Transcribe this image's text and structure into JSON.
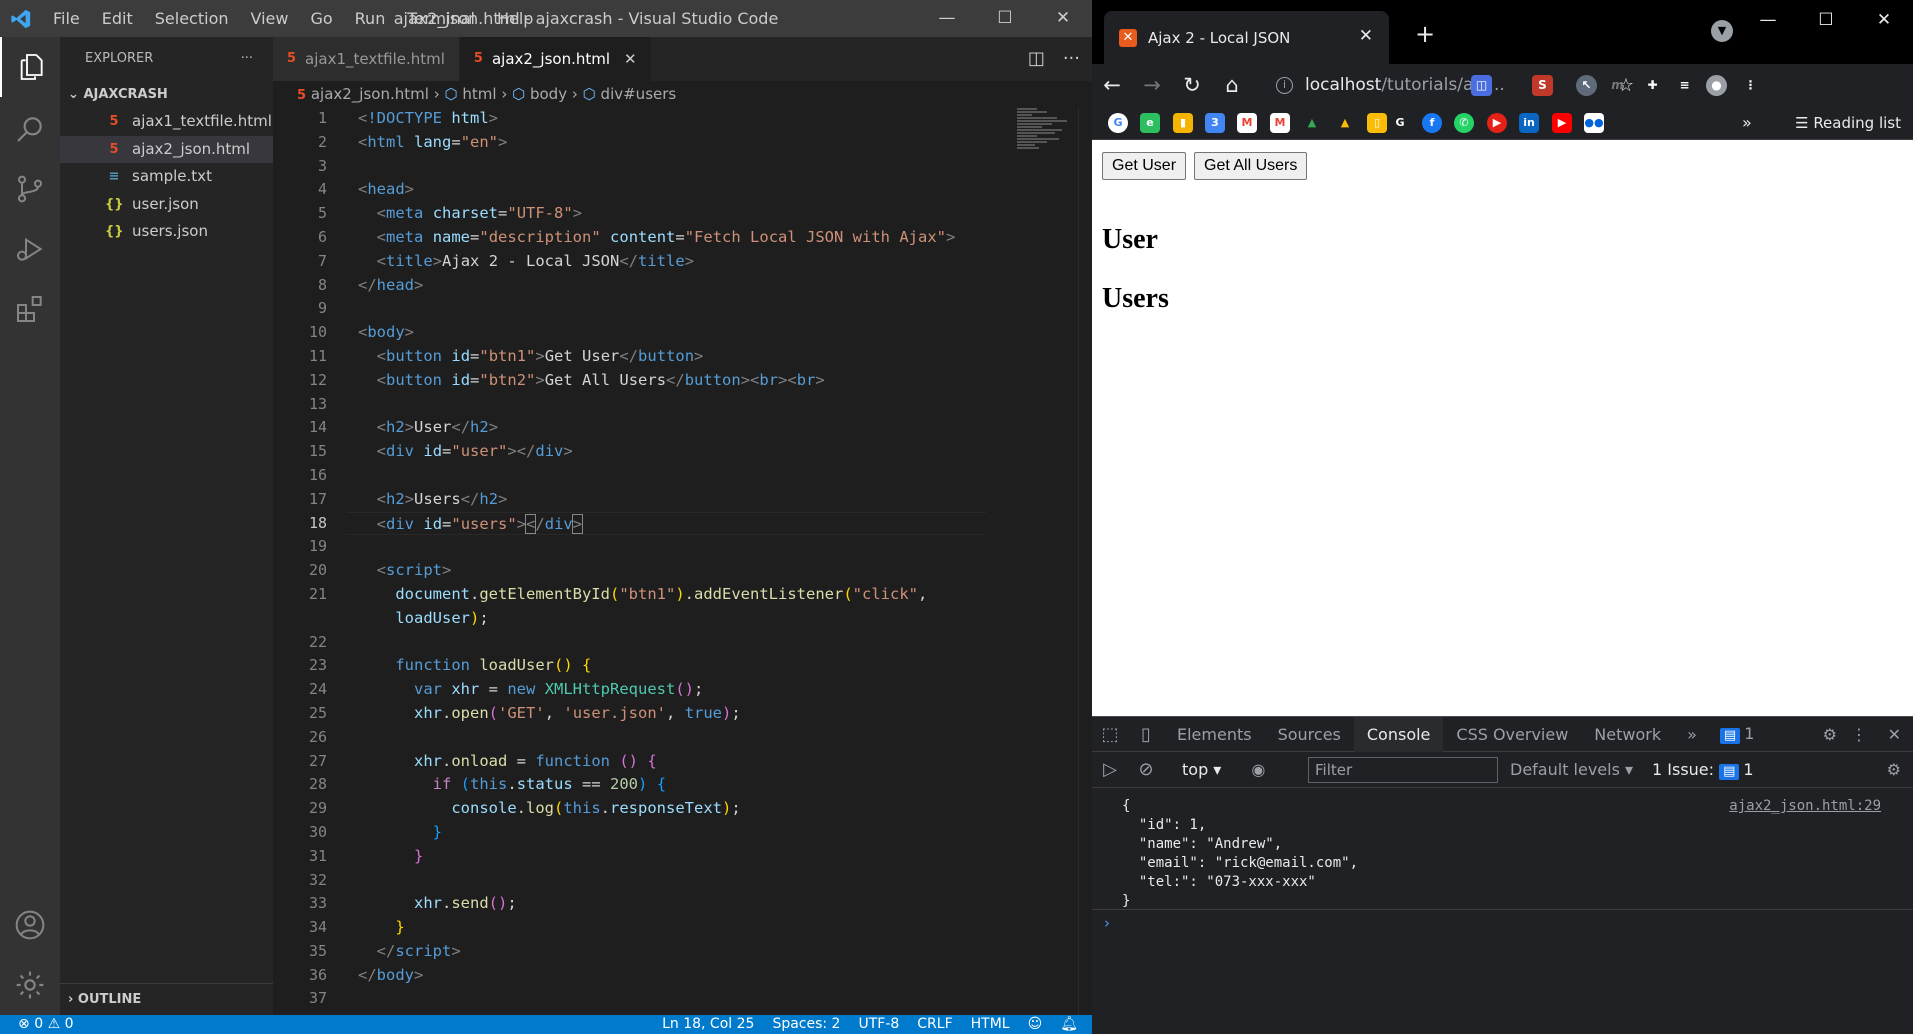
{
  "vscode": {
    "menu": [
      "File",
      "Edit",
      "Selection",
      "View",
      "Go",
      "Run",
      "Terminal",
      "Help"
    ],
    "window_title": "ajax2_json.html - ajaxcrash - Visual Studio Code",
    "explorer": {
      "title": "EXPLORER",
      "more": "···",
      "folder": "AJAXCRASH",
      "files": [
        {
          "name": "ajax1_textfile.html",
          "icon": "html-file-icon",
          "color": "#e44d26"
        },
        {
          "name": "ajax2_json.html",
          "icon": "html-file-icon",
          "color": "#e44d26"
        },
        {
          "name": "sample.txt",
          "icon": "text-file-icon",
          "color": "#519aba"
        },
        {
          "name": "user.json",
          "icon": "json-file-icon",
          "color": "#cbcb41"
        },
        {
          "name": "users.json",
          "icon": "json-file-icon",
          "color": "#cbcb41"
        }
      ],
      "outline": "OUTLINE"
    },
    "tabs": [
      {
        "label": "ajax1_textfile.html"
      },
      {
        "label": "ajax2_json.html"
      }
    ],
    "breadcrumb": [
      "ajax2_json.html",
      "html",
      "body",
      "div#users"
    ],
    "line_numbers": [
      "1",
      "2",
      "3",
      "4",
      "5",
      "6",
      "7",
      "8",
      "9",
      "10",
      "11",
      "12",
      "13",
      "14",
      "15",
      "16",
      "17",
      "18",
      "19",
      "20",
      "21",
      "",
      "22",
      "23",
      "24",
      "25",
      "26",
      "27",
      "28",
      "29",
      "30",
      "31",
      "32",
      "33",
      "34",
      "35",
      "36",
      "37"
    ],
    "status": {
      "errors": "0",
      "warnings": "0",
      "position": "Ln 18, Col 25",
      "spaces": "Spaces: 2",
      "encoding": "UTF-8",
      "eol": "CRLF",
      "language": "HTML"
    }
  },
  "chrome": {
    "tab_title": "Ajax 2 - Local JSON",
    "url_host": "localhost",
    "url_path": "/tutorials/aja...",
    "bookmarks_more": "»",
    "reading_list": "Reading list",
    "page": {
      "btn1": "Get User",
      "btn2": "Get All Users",
      "h2_user": "User",
      "h2_users": "Users"
    },
    "devtools": {
      "tabs": [
        "Elements",
        "Sources",
        "Console",
        "CSS Overview",
        "Network"
      ],
      "more": "»",
      "issues_count": "1",
      "context": "top",
      "filter_placeholder": "Filter",
      "levels": "Default levels",
      "issues_label": "1 Issue:",
      "issues_num": "1",
      "log_source": "ajax2_json.html:29",
      "log_text": "{\n  \"id\": 1,\n  \"name\": \"Andrew\",\n  \"email\": \"rick@email.com\",\n  \"tel:\": \"073-xxx-xxx\"\n}",
      "prompt": "›"
    }
  }
}
